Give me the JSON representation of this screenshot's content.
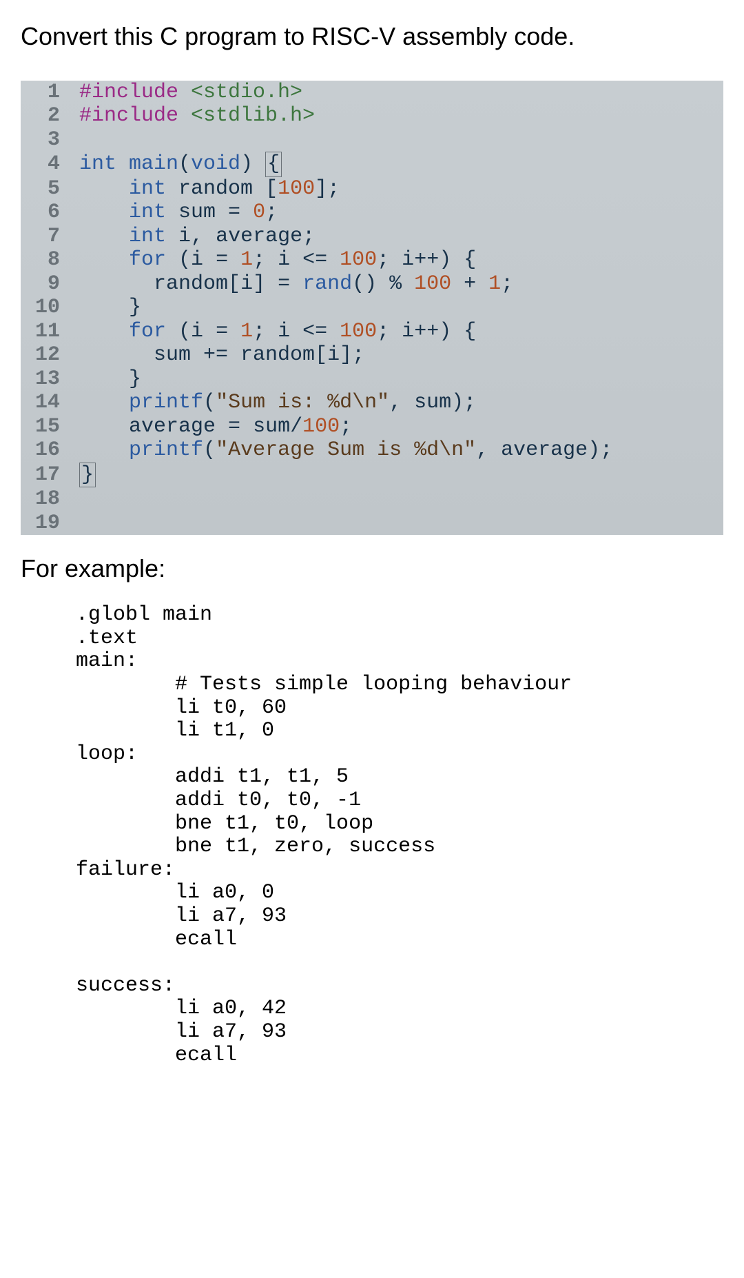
{
  "prompt": "Convert this C program to RISC-V assembly code.",
  "c_code": {
    "lines": [
      {
        "n": "1",
        "tokens": [
          [
            "pp",
            "#include "
          ],
          [
            "inc",
            "<stdio.h>"
          ]
        ]
      },
      {
        "n": "2",
        "tokens": [
          [
            "pp",
            "#include "
          ],
          [
            "inc",
            "<stdlib.h>"
          ]
        ]
      },
      {
        "n": "3",
        "tokens": []
      },
      {
        "n": "4",
        "tokens": [
          [
            "kw",
            "int "
          ],
          [
            "fn",
            "main"
          ],
          [
            "punc",
            "("
          ],
          [
            "kw",
            "void"
          ],
          [
            "punc",
            ") "
          ],
          [
            "bracebox",
            "{"
          ]
        ]
      },
      {
        "n": "5",
        "tokens": [
          [
            "id",
            "    "
          ],
          [
            "kw",
            "int "
          ],
          [
            "id",
            "random "
          ],
          [
            "punc",
            "["
          ],
          [
            "num",
            "100"
          ],
          [
            "punc",
            "];"
          ]
        ]
      },
      {
        "n": "6",
        "tokens": [
          [
            "id",
            "    "
          ],
          [
            "kw",
            "int "
          ],
          [
            "id",
            "sum "
          ],
          [
            "punc",
            "= "
          ],
          [
            "num",
            "0"
          ],
          [
            "punc",
            ";"
          ]
        ]
      },
      {
        "n": "7",
        "tokens": [
          [
            "id",
            "    "
          ],
          [
            "kw",
            "int "
          ],
          [
            "id",
            "i"
          ],
          [
            "punc",
            ", "
          ],
          [
            "id",
            "average"
          ],
          [
            "punc",
            ";"
          ]
        ]
      },
      {
        "n": "8",
        "tokens": [
          [
            "id",
            "    "
          ],
          [
            "kw",
            "for "
          ],
          [
            "punc",
            "("
          ],
          [
            "id",
            "i "
          ],
          [
            "punc",
            "= "
          ],
          [
            "num",
            "1"
          ],
          [
            "punc",
            "; "
          ],
          [
            "id",
            "i "
          ],
          [
            "punc",
            "<= "
          ],
          [
            "num",
            "100"
          ],
          [
            "punc",
            "; "
          ],
          [
            "id",
            "i"
          ],
          [
            "punc",
            "++) {"
          ]
        ]
      },
      {
        "n": "9",
        "tokens": [
          [
            "id",
            "      random"
          ],
          [
            "punc",
            "["
          ],
          [
            "id",
            "i"
          ],
          [
            "punc",
            "] = "
          ],
          [
            "fn",
            "rand"
          ],
          [
            "punc",
            "() % "
          ],
          [
            "num",
            "100"
          ],
          [
            "punc",
            " + "
          ],
          [
            "num",
            "1"
          ],
          [
            "punc",
            ";"
          ]
        ]
      },
      {
        "n": "10",
        "tokens": [
          [
            "punc",
            "    }"
          ]
        ]
      },
      {
        "n": "11",
        "tokens": [
          [
            "id",
            "    "
          ],
          [
            "kw",
            "for "
          ],
          [
            "punc",
            "("
          ],
          [
            "id",
            "i "
          ],
          [
            "punc",
            "= "
          ],
          [
            "num",
            "1"
          ],
          [
            "punc",
            "; "
          ],
          [
            "id",
            "i "
          ],
          [
            "punc",
            "<= "
          ],
          [
            "num",
            "100"
          ],
          [
            "punc",
            "; "
          ],
          [
            "id",
            "i"
          ],
          [
            "punc",
            "++) {"
          ]
        ]
      },
      {
        "n": "12",
        "tokens": [
          [
            "id",
            "      sum "
          ],
          [
            "punc",
            "+= "
          ],
          [
            "id",
            "random"
          ],
          [
            "punc",
            "["
          ],
          [
            "id",
            "i"
          ],
          [
            "punc",
            "];"
          ]
        ]
      },
      {
        "n": "13",
        "tokens": [
          [
            "punc",
            "    }"
          ]
        ]
      },
      {
        "n": "14",
        "tokens": [
          [
            "id",
            "    "
          ],
          [
            "fn",
            "printf"
          ],
          [
            "punc",
            "("
          ],
          [
            "str",
            "\"Sum is: %d\\n\""
          ],
          [
            "punc",
            ", "
          ],
          [
            "id",
            "sum"
          ],
          [
            "punc",
            ");"
          ]
        ]
      },
      {
        "n": "15",
        "tokens": [
          [
            "id",
            "    average "
          ],
          [
            "punc",
            "= "
          ],
          [
            "id",
            "sum"
          ],
          [
            "punc",
            "/"
          ],
          [
            "num",
            "100"
          ],
          [
            "punc",
            ";"
          ]
        ]
      },
      {
        "n": "16",
        "tokens": [
          [
            "id",
            "    "
          ],
          [
            "fn",
            "printf"
          ],
          [
            "punc",
            "("
          ],
          [
            "str",
            "\"Average Sum is %d\\n\""
          ],
          [
            "punc",
            ", "
          ],
          [
            "id",
            "average"
          ],
          [
            "punc",
            ");"
          ]
        ]
      },
      {
        "n": "17",
        "tokens": [
          [
            "bracebox",
            "}"
          ]
        ]
      },
      {
        "n": "18",
        "tokens": []
      },
      {
        "n": "19",
        "tokens": []
      }
    ]
  },
  "example_label": "For example:",
  "asm_code": ".globl main\n.text\nmain:\n        # Tests simple looping behaviour\n        li t0, 60\n        li t1, 0\nloop:\n        addi t1, t1, 5\n        addi t0, t0, -1\n        bne t1, t0, loop\n        bne t1, zero, success\nfailure:\n        li a0, 0\n        li a7, 93\n        ecall\n\nsuccess:\n        li a0, 42\n        li a7, 93\n        ecall"
}
